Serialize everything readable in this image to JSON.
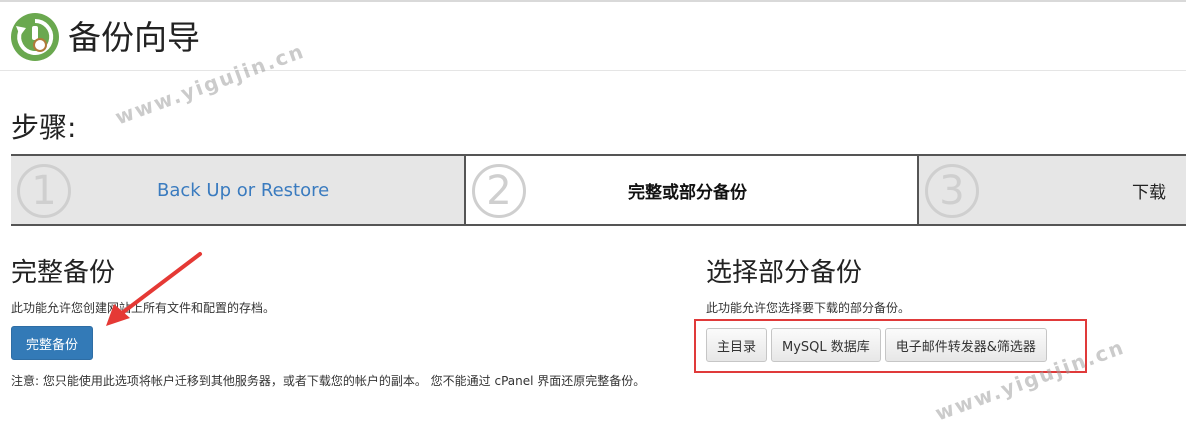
{
  "header": {
    "title": "备份向导"
  },
  "steps": {
    "heading": "步骤:",
    "items": [
      {
        "number": "①",
        "label": "Back Up or Restore"
      },
      {
        "number": "②",
        "label": "完整或部分备份"
      },
      {
        "number": "③",
        "label": "下载"
      }
    ]
  },
  "full_backup": {
    "title": "完整备份",
    "description": "此功能允许您创建网站上所有文件和配置的存档。",
    "button_label": "完整备份",
    "note": "注意: 您只能使用此选项将帐户迁移到其他服务器，或者下载您的帐户的副本。 您不能通过 cPanel 界面还原完整备份。"
  },
  "partial_backup": {
    "title": "选择部分备份",
    "description": "此功能允许您选择要下载的部分备份。",
    "buttons": [
      "主目录",
      "MySQL 数据库",
      "电子邮件转发器&筛选器"
    ]
  },
  "watermark": {
    "text1": "www.yigujin.cn",
    "text2": "www.yigujin.cn"
  },
  "colors": {
    "primary": "#337ab7",
    "link": "#3a7bbf",
    "highlight_outline": "#e03a3a",
    "arrow": "#e53935",
    "icon_green": "#6aa84f"
  }
}
